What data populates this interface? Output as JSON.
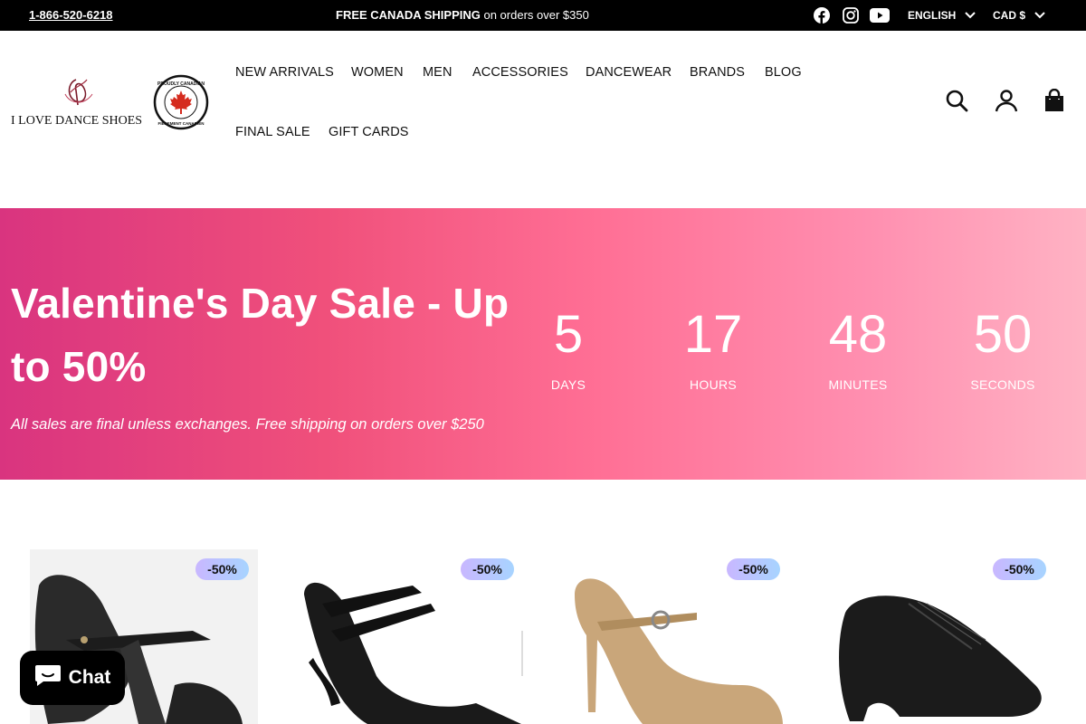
{
  "topbar": {
    "phone": "1-866-520-6218",
    "promo_bold": "FREE CANADA SHIPPING",
    "promo_rest": " on orders over $350",
    "language": "ENGLISH",
    "currency": "CAD $",
    "social": [
      "facebook-icon",
      "instagram-icon",
      "youtube-icon"
    ]
  },
  "header": {
    "logo_text": "I LOVE DANCE SHOES",
    "badge_text_top": "PROUDLY CANADIAN",
    "badge_text_bottom": "FIÈREMENT CANADIEN",
    "nav": [
      "NEW ARRIVALS",
      "WOMEN",
      "MEN",
      "ACCESSORIES",
      "DANCEWEAR",
      "BRANDS",
      "BLOG",
      "FINAL SALE",
      "GIFT CARDS"
    ]
  },
  "hero": {
    "title": "Valentine's Day Sale - Up to 50%",
    "subtitle": "All sales are final unless exchanges. Free shipping on orders over $250",
    "countdown": [
      {
        "value": "5",
        "label": "DAYS"
      },
      {
        "value": "17",
        "label": "HOURS"
      },
      {
        "value": "48",
        "label": "MINUTES"
      },
      {
        "value": "50",
        "label": "SECONDS"
      }
    ]
  },
  "products": [
    {
      "badge": "-50%"
    },
    {
      "badge": "-50%"
    },
    {
      "badge": "-50%"
    },
    {
      "badge": "-50%"
    }
  ],
  "chat": {
    "label": "Chat"
  },
  "colors": {
    "topbar_bg": "#000000",
    "hero_gradient_start": "#d9347f",
    "hero_gradient_end": "#ffb3c4",
    "badge_gradient_start": "#c9b7ff",
    "badge_gradient_end": "#a7d4ff"
  }
}
